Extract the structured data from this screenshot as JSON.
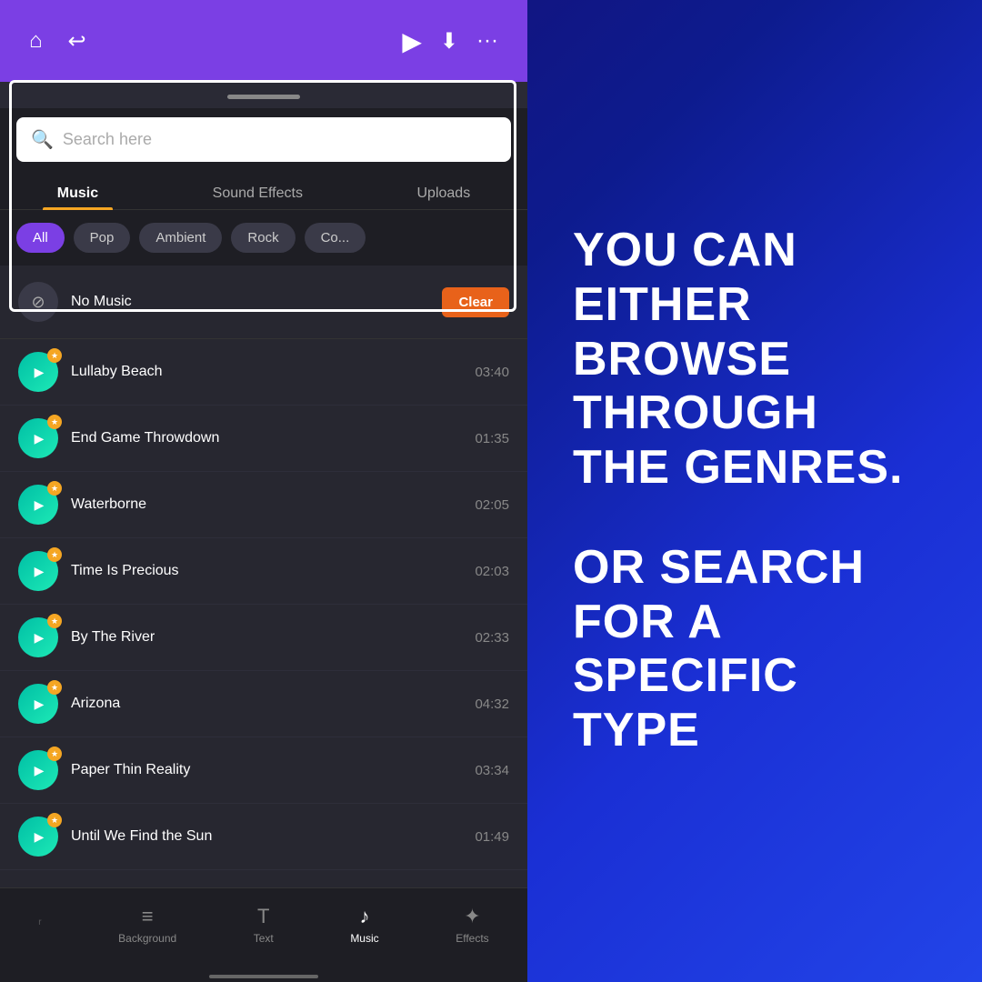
{
  "topBar": {
    "homeIcon": "⌂",
    "backIcon": "↩",
    "playIcon": "▶",
    "downloadIcon": "⬇",
    "moreIcon": "···"
  },
  "search": {
    "placeholder": "Search here",
    "icon": "🔍"
  },
  "tabs": [
    {
      "label": "Music",
      "active": true
    },
    {
      "label": "Sound Effects",
      "active": false
    },
    {
      "label": "Uploads",
      "active": false
    }
  ],
  "genres": [
    {
      "label": "All",
      "active": true
    },
    {
      "label": "Pop",
      "active": false
    },
    {
      "label": "Ambient",
      "active": false
    },
    {
      "label": "Rock",
      "active": false
    },
    {
      "label": "Co...",
      "active": false
    }
  ],
  "noMusicRow": {
    "label": "No Music",
    "clearButton": "Clear"
  },
  "tracks": [
    {
      "name": "Lullaby Beach",
      "duration": "03:40"
    },
    {
      "name": "End Game Throwdown",
      "duration": "01:35"
    },
    {
      "name": "Waterborne",
      "duration": "02:05"
    },
    {
      "name": "Time Is Precious",
      "duration": "02:03"
    },
    {
      "name": "By The River",
      "duration": "02:33"
    },
    {
      "name": "Arizona",
      "duration": "04:32"
    },
    {
      "name": "Paper Thin Reality",
      "duration": "03:34"
    },
    {
      "name": "Until We Find the Sun",
      "duration": "01:49"
    }
  ],
  "bottomNav": [
    {
      "icon": "≡",
      "label": "r",
      "active": false
    },
    {
      "icon": "⊟",
      "label": "Background",
      "active": false
    },
    {
      "icon": "T",
      "label": "Text",
      "active": false
    },
    {
      "icon": "♪",
      "label": "Music",
      "active": true
    },
    {
      "icon": "✦",
      "label": "Effects",
      "active": false
    }
  ],
  "instructionLine1": "YOU CAN EITHER",
  "instructionLine2": "BROWSE THROUGH",
  "instructionLine3": "THE GENRES.",
  "instructionLine4": "OR SEARCH FOR A",
  "instructionLine5": "SPECIFIC TYPE"
}
